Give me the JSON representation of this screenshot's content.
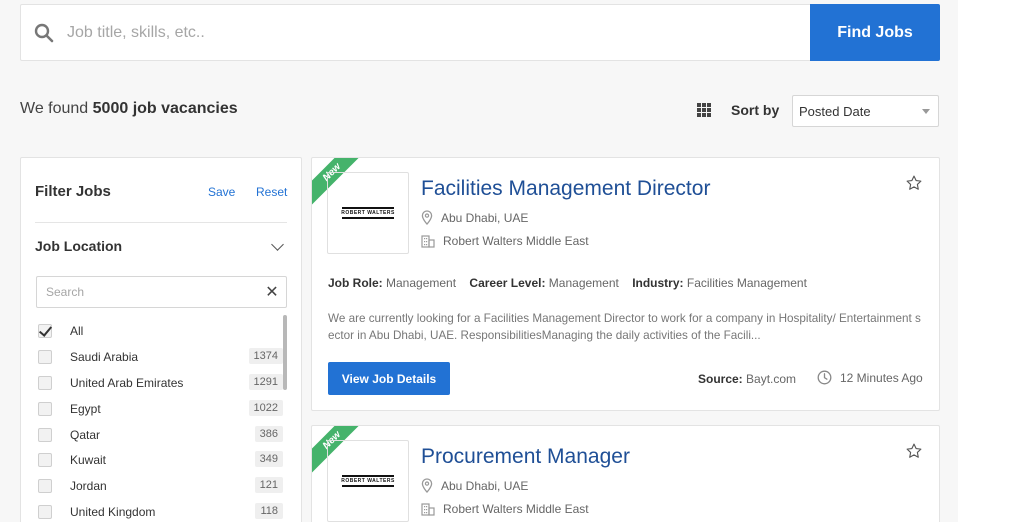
{
  "search": {
    "placeholder": "Job title, skills, etc..",
    "value": "",
    "button_label": "Find Jobs"
  },
  "results": {
    "prefix": "We found",
    "count_text": "5000 job vacancies"
  },
  "sort": {
    "label": "Sort by",
    "selected": "Posted Date"
  },
  "filter": {
    "title": "Filter Jobs",
    "save_label": "Save",
    "reset_label": "Reset",
    "location": {
      "title": "Job Location",
      "search_placeholder": "Search",
      "items": [
        {
          "name": "All",
          "count": "",
          "checked": true
        },
        {
          "name": "Saudi Arabia",
          "count": "1374",
          "checked": false
        },
        {
          "name": "United Arab Emirates",
          "count": "1291",
          "checked": false
        },
        {
          "name": "Egypt",
          "count": "1022",
          "checked": false
        },
        {
          "name": "Qatar",
          "count": "386",
          "checked": false
        },
        {
          "name": "Kuwait",
          "count": "349",
          "checked": false
        },
        {
          "name": "Jordan",
          "count": "121",
          "checked": false
        },
        {
          "name": "United Kingdom",
          "count": "118",
          "checked": false
        }
      ]
    }
  },
  "jobs": [
    {
      "badge": "New",
      "logo_text": "ROBERT WALTERS",
      "title": "Facilities Management Director",
      "location": "Abu Dhabi, UAE",
      "company": "Robert Walters Middle East",
      "role_label": "Job Role:",
      "role": "Management",
      "level_label": "Career Level:",
      "level": "Management",
      "industry_label": "Industry:",
      "industry": "Facilities Management",
      "description": "We are currently looking for a Facilities Management Director to work for a company in Hospitality/ Entertainment sector in Abu Dhabi, UAE.  ResponsibilitiesManaging the daily activities of the Facili...",
      "button_label": "View Job Details",
      "source_label": "Source:",
      "source": "Bayt.com",
      "posted": "12 Minutes Ago"
    },
    {
      "badge": "New",
      "logo_text": "ROBERT WALTERS",
      "title": "Procurement Manager",
      "location": "Abu Dhabi, UAE",
      "company": "Robert Walters Middle East"
    }
  ],
  "colors": {
    "primary": "#2272d4",
    "title_link": "#1f4f96",
    "badge_green": "#45b36b"
  }
}
